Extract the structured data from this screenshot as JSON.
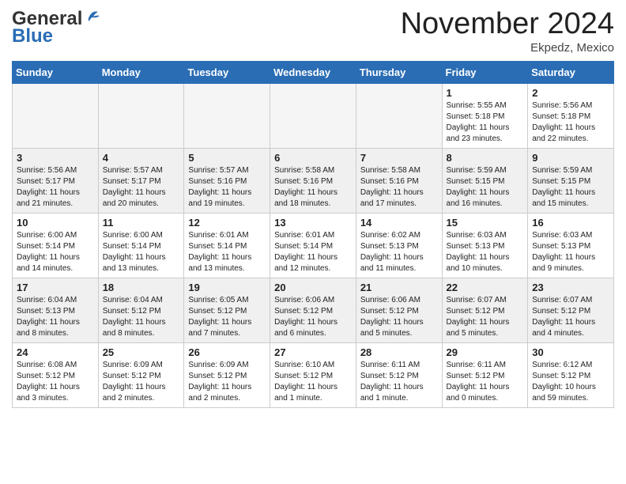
{
  "header": {
    "logo_line1": "General",
    "logo_line2": "Blue",
    "month": "November 2024",
    "location": "Ekpedz, Mexico"
  },
  "weekdays": [
    "Sunday",
    "Monday",
    "Tuesday",
    "Wednesday",
    "Thursday",
    "Friday",
    "Saturday"
  ],
  "weeks": [
    [
      {
        "day": "",
        "info": ""
      },
      {
        "day": "",
        "info": ""
      },
      {
        "day": "",
        "info": ""
      },
      {
        "day": "",
        "info": ""
      },
      {
        "day": "",
        "info": ""
      },
      {
        "day": "1",
        "info": "Sunrise: 5:55 AM\nSunset: 5:18 PM\nDaylight: 11 hours\nand 23 minutes."
      },
      {
        "day": "2",
        "info": "Sunrise: 5:56 AM\nSunset: 5:18 PM\nDaylight: 11 hours\nand 22 minutes."
      }
    ],
    [
      {
        "day": "3",
        "info": "Sunrise: 5:56 AM\nSunset: 5:17 PM\nDaylight: 11 hours\nand 21 minutes."
      },
      {
        "day": "4",
        "info": "Sunrise: 5:57 AM\nSunset: 5:17 PM\nDaylight: 11 hours\nand 20 minutes."
      },
      {
        "day": "5",
        "info": "Sunrise: 5:57 AM\nSunset: 5:16 PM\nDaylight: 11 hours\nand 19 minutes."
      },
      {
        "day": "6",
        "info": "Sunrise: 5:58 AM\nSunset: 5:16 PM\nDaylight: 11 hours\nand 18 minutes."
      },
      {
        "day": "7",
        "info": "Sunrise: 5:58 AM\nSunset: 5:16 PM\nDaylight: 11 hours\nand 17 minutes."
      },
      {
        "day": "8",
        "info": "Sunrise: 5:59 AM\nSunset: 5:15 PM\nDaylight: 11 hours\nand 16 minutes."
      },
      {
        "day": "9",
        "info": "Sunrise: 5:59 AM\nSunset: 5:15 PM\nDaylight: 11 hours\nand 15 minutes."
      }
    ],
    [
      {
        "day": "10",
        "info": "Sunrise: 6:00 AM\nSunset: 5:14 PM\nDaylight: 11 hours\nand 14 minutes."
      },
      {
        "day": "11",
        "info": "Sunrise: 6:00 AM\nSunset: 5:14 PM\nDaylight: 11 hours\nand 13 minutes."
      },
      {
        "day": "12",
        "info": "Sunrise: 6:01 AM\nSunset: 5:14 PM\nDaylight: 11 hours\nand 13 minutes."
      },
      {
        "day": "13",
        "info": "Sunrise: 6:01 AM\nSunset: 5:14 PM\nDaylight: 11 hours\nand 12 minutes."
      },
      {
        "day": "14",
        "info": "Sunrise: 6:02 AM\nSunset: 5:13 PM\nDaylight: 11 hours\nand 11 minutes."
      },
      {
        "day": "15",
        "info": "Sunrise: 6:03 AM\nSunset: 5:13 PM\nDaylight: 11 hours\nand 10 minutes."
      },
      {
        "day": "16",
        "info": "Sunrise: 6:03 AM\nSunset: 5:13 PM\nDaylight: 11 hours\nand 9 minutes."
      }
    ],
    [
      {
        "day": "17",
        "info": "Sunrise: 6:04 AM\nSunset: 5:13 PM\nDaylight: 11 hours\nand 8 minutes."
      },
      {
        "day": "18",
        "info": "Sunrise: 6:04 AM\nSunset: 5:12 PM\nDaylight: 11 hours\nand 8 minutes."
      },
      {
        "day": "19",
        "info": "Sunrise: 6:05 AM\nSunset: 5:12 PM\nDaylight: 11 hours\nand 7 minutes."
      },
      {
        "day": "20",
        "info": "Sunrise: 6:06 AM\nSunset: 5:12 PM\nDaylight: 11 hours\nand 6 minutes."
      },
      {
        "day": "21",
        "info": "Sunrise: 6:06 AM\nSunset: 5:12 PM\nDaylight: 11 hours\nand 5 minutes."
      },
      {
        "day": "22",
        "info": "Sunrise: 6:07 AM\nSunset: 5:12 PM\nDaylight: 11 hours\nand 5 minutes."
      },
      {
        "day": "23",
        "info": "Sunrise: 6:07 AM\nSunset: 5:12 PM\nDaylight: 11 hours\nand 4 minutes."
      }
    ],
    [
      {
        "day": "24",
        "info": "Sunrise: 6:08 AM\nSunset: 5:12 PM\nDaylight: 11 hours\nand 3 minutes."
      },
      {
        "day": "25",
        "info": "Sunrise: 6:09 AM\nSunset: 5:12 PM\nDaylight: 11 hours\nand 2 minutes."
      },
      {
        "day": "26",
        "info": "Sunrise: 6:09 AM\nSunset: 5:12 PM\nDaylight: 11 hours\nand 2 minutes."
      },
      {
        "day": "27",
        "info": "Sunrise: 6:10 AM\nSunset: 5:12 PM\nDaylight: 11 hours\nand 1 minute."
      },
      {
        "day": "28",
        "info": "Sunrise: 6:11 AM\nSunset: 5:12 PM\nDaylight: 11 hours\nand 1 minute."
      },
      {
        "day": "29",
        "info": "Sunrise: 6:11 AM\nSunset: 5:12 PM\nDaylight: 11 hours\nand 0 minutes."
      },
      {
        "day": "30",
        "info": "Sunrise: 6:12 AM\nSunset: 5:12 PM\nDaylight: 10 hours\nand 59 minutes."
      }
    ]
  ]
}
